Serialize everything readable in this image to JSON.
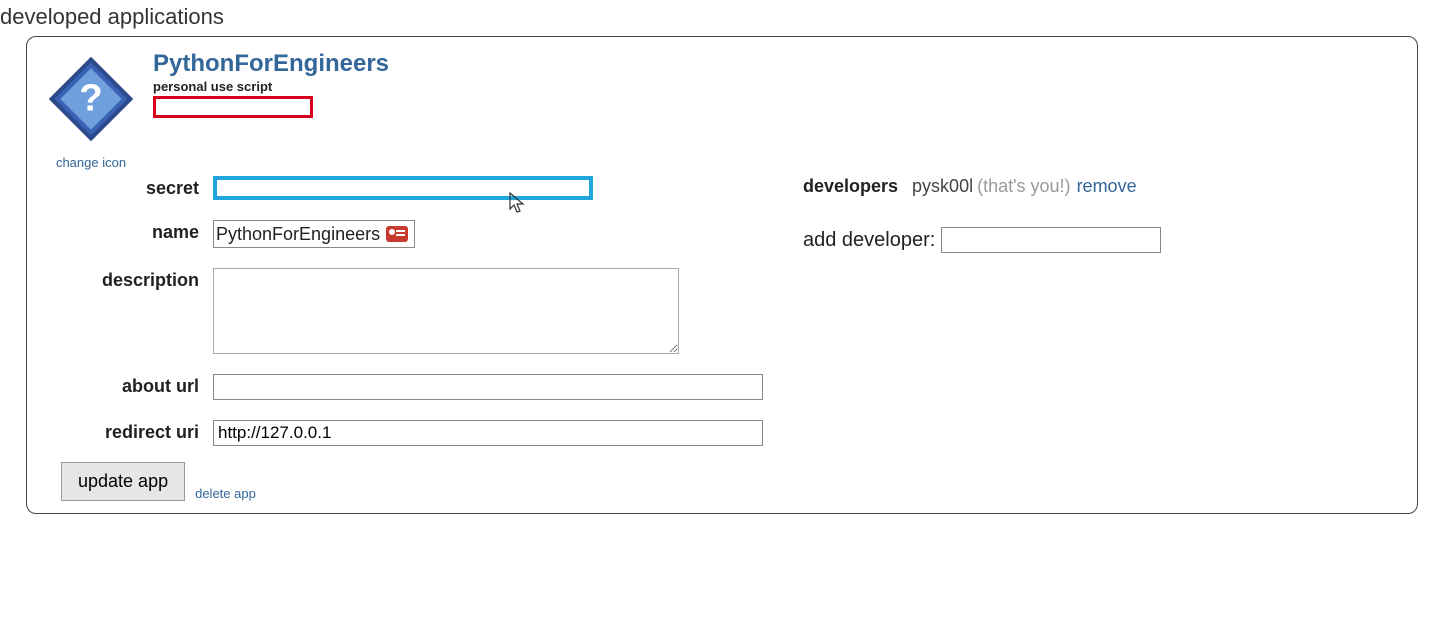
{
  "page": {
    "title": "developed applications"
  },
  "app": {
    "name": "PythonForEngineers",
    "type": "personal use script",
    "change_icon": "change icon",
    "client_id": "",
    "secret_label": "secret",
    "secret_value": "",
    "name_label": "name",
    "name_value": "PythonForEngineers",
    "description_label": "description",
    "description_value": "",
    "about_label": "about url",
    "about_value": "",
    "redirect_label": "redirect uri",
    "redirect_value": "http://127.0.0.1",
    "update_btn": "update app",
    "delete_link": "delete app"
  },
  "developers": {
    "label": "developers",
    "user": "pysk00l",
    "thats_you": "(that's you!)",
    "remove": "remove",
    "add_label": "add developer:",
    "add_value": ""
  }
}
